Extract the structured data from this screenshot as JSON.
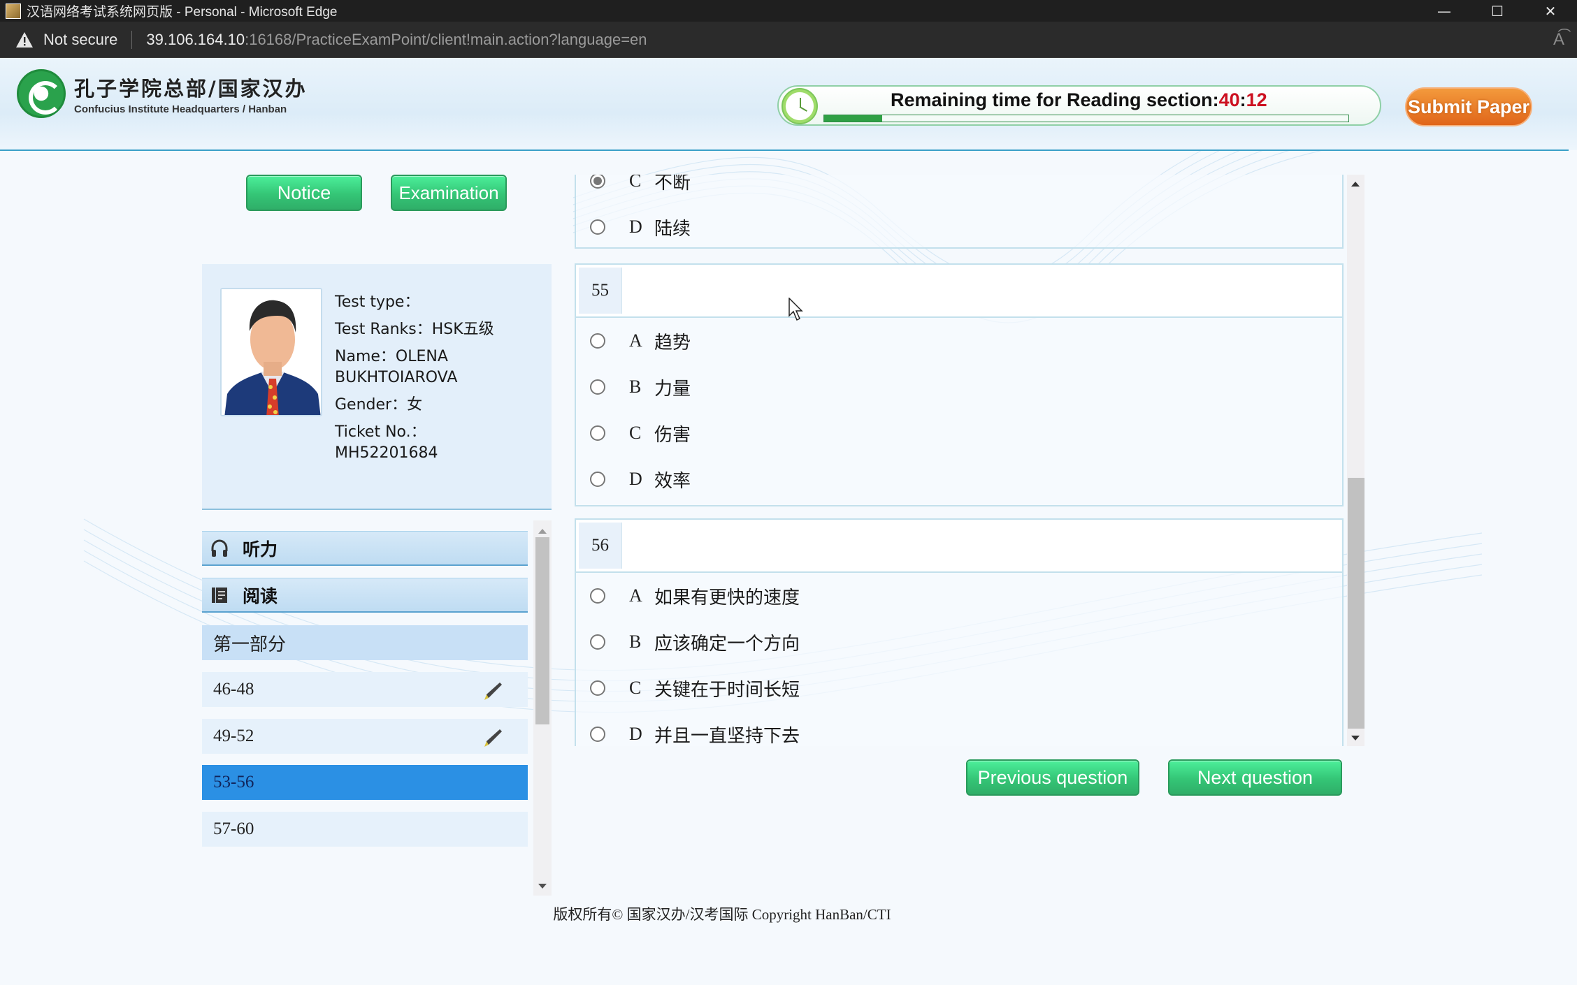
{
  "browser": {
    "window_title": "汉语网络考试系统网页版 - Personal - Microsoft Edge",
    "security_label": "Not secure",
    "url_host": "39.106.164.10",
    "url_rest": ":16168/PracticeExamPoint/client!main.action?language=en",
    "controls": {
      "minimize": "—",
      "maximize": "☐",
      "close": "✕"
    },
    "read_aloud": "A͡"
  },
  "header": {
    "logo_cn": "孔子学院总部/国家汉办",
    "logo_en": "Confucius Institute Headquarters / Hanban",
    "timer_label": "Remaining time for Reading section:",
    "timer_minutes": "40",
    "timer_sep": ":",
    "timer_seconds": "12",
    "time_progress_fraction": 0.11,
    "submit_label": "Submit Paper"
  },
  "colors": {
    "accent_green": "#34c576",
    "submit_orange": "#e8721f",
    "timer_red": "#cc1020",
    "nav_active": "#2b90e4"
  },
  "tabs": {
    "notice_label": "Notice",
    "examination_label": "Examination"
  },
  "candidate": {
    "test_type_label": "Test type：",
    "test_type_value": "",
    "test_ranks_label": "Test Ranks：",
    "test_ranks_value": "HSK五级",
    "name_label": "Name：",
    "name_value_line1": "OLENA",
    "name_value_line2": "BUKHTOIAROVA",
    "gender_label": "Gender：",
    "gender_value": "女",
    "ticket_label": "Ticket No.：",
    "ticket_value": "MH52201684"
  },
  "nav": {
    "sections": [
      {
        "label": "听力",
        "icon": "headphones-icon"
      },
      {
        "label": "阅读",
        "icon": "book-icon"
      }
    ],
    "part_label": "第一部分",
    "items": [
      {
        "label": "46-48",
        "answered": true,
        "active": false
      },
      {
        "label": "49-52",
        "answered": true,
        "active": false
      },
      {
        "label": "53-56",
        "answered": false,
        "active": true
      },
      {
        "label": "57-60",
        "answered": false,
        "active": false
      }
    ]
  },
  "questions": {
    "prev_partial": {
      "options": [
        {
          "letter": "C",
          "text": "不断",
          "selected": true
        },
        {
          "letter": "D",
          "text": "陆续",
          "selected": false
        }
      ]
    },
    "q55": {
      "number": "55",
      "options": [
        {
          "letter": "A",
          "text": "趋势",
          "selected": false
        },
        {
          "letter": "B",
          "text": "力量",
          "selected": false
        },
        {
          "letter": "C",
          "text": "伤害",
          "selected": false
        },
        {
          "letter": "D",
          "text": "效率",
          "selected": false
        }
      ]
    },
    "q56": {
      "number": "56",
      "options": [
        {
          "letter": "A",
          "text": "如果有更快的速度",
          "selected": false
        },
        {
          "letter": "B",
          "text": "应该确定一个方向",
          "selected": false
        },
        {
          "letter": "C",
          "text": "关键在于时间长短",
          "selected": false
        },
        {
          "letter": "D",
          "text": "并且一直坚持下去",
          "selected": false
        }
      ]
    }
  },
  "pager": {
    "previous_label": "Previous question",
    "next_label": "Next question"
  },
  "footer": {
    "copyright": "版权所有© 国家汉办/汉考国际 Copyright HanBan/CTI"
  }
}
